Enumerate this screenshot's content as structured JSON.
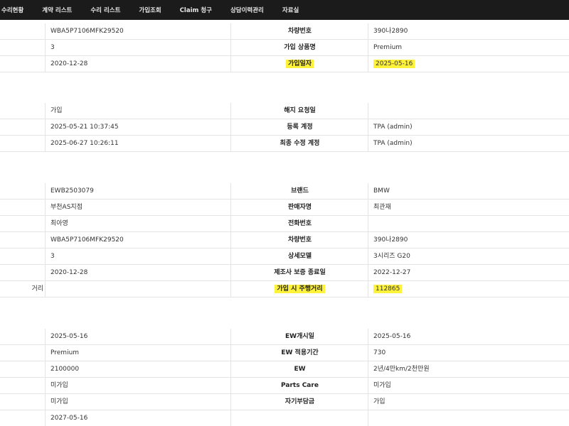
{
  "nav": [
    "수리현황",
    "계약 리스트",
    "수리 리스트",
    "가입조회",
    "Claim 청구",
    "상담이력관리",
    "자료실"
  ],
  "sections": [
    {
      "rows": [
        {
          "left": "WBA5P7106MFK29520",
          "label": "차량번호",
          "right": "390나2890",
          "hl": false
        },
        {
          "left": "3",
          "label": "가입 상품명",
          "right": "Premium",
          "hl": false
        },
        {
          "left": "2020-12-28",
          "label": "가입일자",
          "right": "2025-05-16",
          "hl": true
        }
      ]
    },
    {
      "rows": [
        {
          "left": "가입",
          "label": "해지 요청일",
          "right": "",
          "hl": false
        },
        {
          "left": "2025-05-21 10:37:45",
          "label": "등록 계정",
          "right": "TPA (admin)",
          "hl": false
        },
        {
          "left": "2025-06-27 10:26:11",
          "label": "최종 수정 계정",
          "right": "TPA (admin)",
          "hl": false
        }
      ]
    },
    {
      "rows": [
        {
          "left": "EWB2503079",
          "label": "브랜드",
          "right": "BMW",
          "hl": false
        },
        {
          "left": "부천AS지점",
          "label": "판매자명",
          "right": "최관재",
          "hl": false
        },
        {
          "left": "최아영",
          "label": "전화번호",
          "right": "",
          "hl": false
        },
        {
          "left": "WBA5P7106MFK29520",
          "label": "차량번호",
          "right": "390나2890",
          "hl": false
        },
        {
          "left": "3",
          "label": "상세모델",
          "right": "3시리즈 G20",
          "hl": false
        },
        {
          "left": "2020-12-28",
          "label": "제조사 보증 종료일",
          "right": "2022-12-27",
          "hl": false
        },
        {
          "left": "",
          "label": "가입 시 주행거리",
          "right": "112865",
          "hl": true,
          "edge": "거리"
        }
      ]
    },
    {
      "rows": [
        {
          "left": "2025-05-16",
          "label": "EW개시일",
          "right": "2025-05-16",
          "hl": false
        },
        {
          "left": "Premium",
          "label": "EW 적용기간",
          "right": "730",
          "hl": false
        },
        {
          "left": "2100000",
          "label": "EW",
          "right": "2년/4만km/2천만원",
          "hl": false
        },
        {
          "left": "미가입",
          "label": "Parts Care",
          "right": "미가입",
          "hl": false
        },
        {
          "left": "미가입",
          "label": "자기부담금",
          "right": "가입",
          "hl": false
        },
        {
          "left": "2027-05-16",
          "label": "",
          "right": "",
          "hl": false
        }
      ]
    }
  ]
}
